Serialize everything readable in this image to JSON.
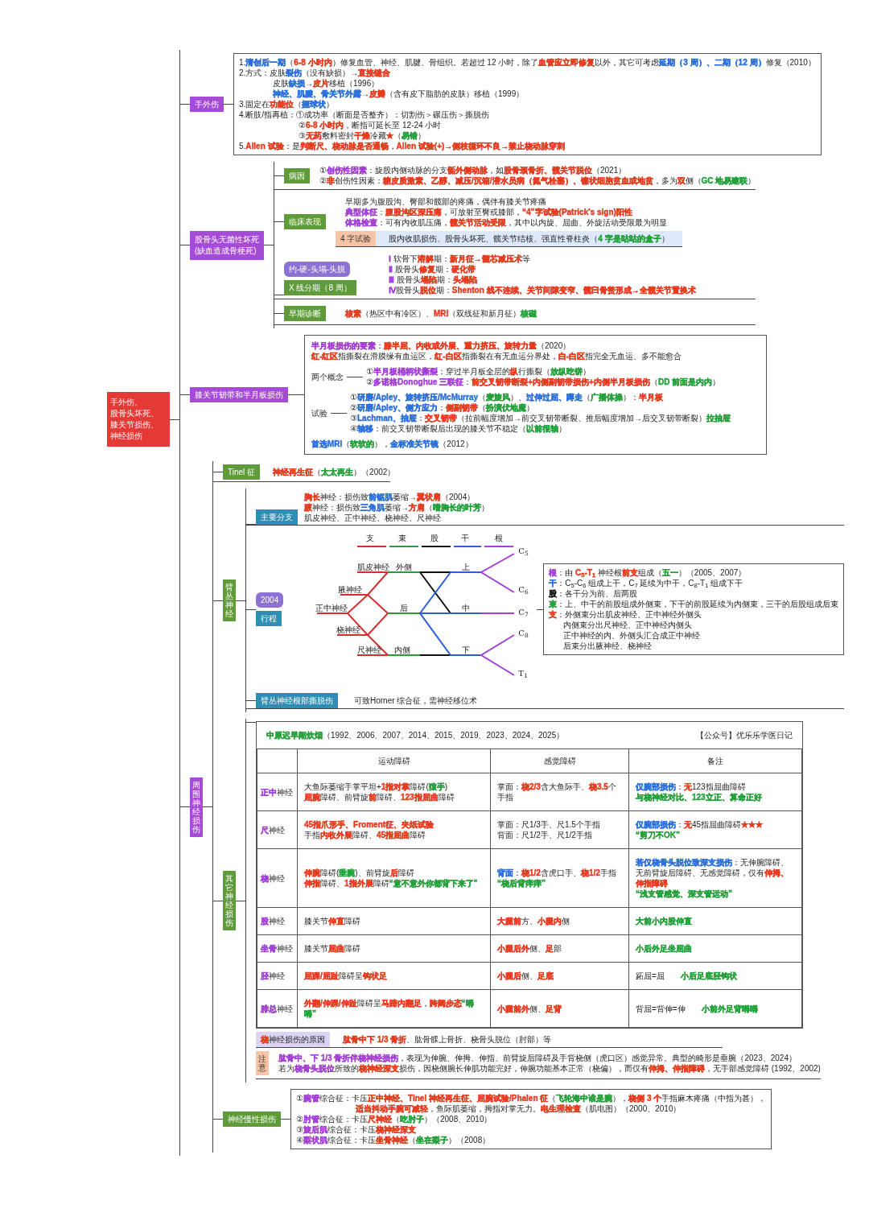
{
  "root": {
    "lines": [
      "手外伤、",
      "股骨头坏死、",
      "膝关节损伤、",
      "神经损伤"
    ]
  },
  "hand_trauma": {
    "label": "手外伤",
    "lines": [
      [
        "1.",
        {
          "text": "清创后一期",
          "color": "#2a6fdb"
        },
        "（",
        {
          "text": "6-8 小时内",
          "color": "#e53b1f"
        },
        "）修复血管、神经、肌腱、骨组织。若超过 12 小时，除了",
        {
          "text": "血管应立即修复",
          "color": "#e53b1f"
        },
        "以外，其它可考虑",
        {
          "text": "延期（3 周）、二期（12 周）",
          "color": "#2a6fdb"
        },
        "修复（2010）"
      ],
      [
        "2.方式：皮肤",
        {
          "text": "裂伤",
          "color": "#2a6fdb"
        },
        "（没有缺损）→",
        {
          "text": "直接缝合",
          "color": "#e53b1f"
        }
      ],
      {
        "kind": "sub",
        "segments": [
          "皮肤",
          {
            "text": "缺损",
            "color": "#2a6fdb"
          },
          "→",
          {
            "text": "皮片",
            "color": "#e53b1f"
          },
          "移植（1996）"
        ]
      },
      {
        "kind": "sub",
        "segments": [
          {
            "text": "神经、肌腱、骨关节外露",
            "color": "#2a6fdb"
          },
          "→",
          {
            "text": "皮瓣",
            "color": "#e53b1f"
          },
          "（含有皮下脂肪的皮肤）移植（1999）"
        ]
      },
      [
        "3.固定在",
        {
          "text": "功能位",
          "color": "#e53b1f"
        },
        "（",
        {
          "text": "握球状",
          "color": "#2a6fdb"
        },
        "）"
      ],
      [
        "4.断肢/指再植：①成功率（断面是否整齐）：切割伤＞碾压伤＞撕脱伤"
      ],
      {
        "kind": "sub2",
        "segments": [
          "②",
          {
            "text": "6-8 小时内",
            "color": "#e53b1f"
          },
          "，断指可延长至 12-24 小时"
        ]
      },
      {
        "kind": "sub2",
        "segments": [
          "③",
          {
            "text": "无药",
            "color": "#e53b1f"
          },
          "敷料密封",
          {
            "text": "干燥",
            "color": "#e53b1f"
          },
          "冷藏",
          {
            "text": "★",
            "color": "#e53b1f"
          },
          "（",
          {
            "text": "易错",
            "color": "#23a03a"
          },
          "）"
        ]
      },
      [
        "5.",
        {
          "text": "Allen 试验",
          "color": "#e53b1f"
        },
        "：是",
        {
          "text": "判断尺、桡动脉是否通畅",
          "color": "#e53b1f"
        },
        "，",
        {
          "text": "Allen 试验(+)→侧枝循环不良→禁止桡动脉穿刺",
          "color": "#e53b1f"
        }
      ]
    ]
  },
  "femoral_head_necrosis": {
    "label_lines": [
      "股骨头无菌性坏死",
      "(缺血造成骨梗死)"
    ],
    "etiology": {
      "label": "病因",
      "lines": [
        [
          "①",
          {
            "text": "创伤性因素",
            "color": "#a33fd6"
          },
          "：旋股内侧动脉的分支",
          {
            "text": "骺外侧动脉",
            "color": "#e53b1f"
          },
          "，如",
          {
            "text": "股骨颈骨折、髋关节脱位",
            "color": "#e53b1f"
          },
          "（2021）"
        ],
        [
          "②",
          {
            "text": "非",
            "color": "#e53b1f"
          },
          "创伤性因素：",
          {
            "text": "糖皮质激素、乙醇、减压/沉箱/潜水员病（氮气栓塞）、镰状细胞贫血或地贫",
            "color": "#e53b1f"
          },
          "，多为",
          {
            "text": "双",
            "color": "#e53b1f"
          },
          "侧（",
          {
            "text": "GC 地易建联",
            "color": "#23a03a"
          },
          "）"
        ]
      ]
    },
    "clinical": {
      "label": "临床表现",
      "lines": [
        [
          "早期多为腹股沟、臀部和髋部的疼痛，偶伴有膝关节疼痛"
        ],
        [
          {
            "text": "典型体征",
            "color": "#a33fd6"
          },
          "：",
          {
            "text": "腹股沟区深压痛",
            "color": "#e53b1f"
          },
          "，可放射至臀或膝部，",
          {
            "text": "“4”字试验(Patrick's sign)阳性",
            "color": "#e53b1f"
          }
        ],
        [
          {
            "text": "体格检查",
            "color": "#a33fd6"
          },
          "：可有内收肌压痛，",
          {
            "text": "髋关节活动受限",
            "color": "#e53b1f"
          },
          "，其中以内旋、屈曲、外旋活动受限最为明显"
        ]
      ],
      "four_test": {
        "label": "4 字试验",
        "text": [
          "股内收肌损伤、股骨头坏死、髋关节结核、强直性脊柱炎（",
          {
            "text": "4 字是咕咕的盒子",
            "color": "#23a03a"
          },
          "）"
        ]
      }
    },
    "xray_staging": {
      "label": "X 线分期（8 周）",
      "bubble": "约-硬-头塌-头脱",
      "lines": [
        [
          {
            "text": "Ⅰ",
            "color": "#a33fd6"
          },
          " 软骨下",
          {
            "text": "溶解",
            "color": "#e53b1f"
          },
          "期：",
          {
            "text": "新月征→髓芯减压术",
            "color": "#e53b1f"
          },
          "等"
        ],
        [
          {
            "text": "Ⅱ",
            "color": "#a33fd6"
          },
          " 股骨头",
          {
            "text": "修复",
            "color": "#e53b1f"
          },
          "期：",
          {
            "text": "硬化带",
            "color": "#e53b1f"
          }
        ],
        [
          {
            "text": "Ⅲ",
            "color": "#a33fd6"
          },
          " 股骨头",
          {
            "text": "塌陷",
            "color": "#e53b1f"
          },
          "期：",
          {
            "text": "头塌陷",
            "color": "#e53b1f"
          }
        ],
        [
          {
            "text": "Ⅳ",
            "color": "#a33fd6"
          },
          "股骨头",
          {
            "text": "脱位",
            "color": "#e53b1f"
          },
          "期：",
          {
            "text": "Shenton 线不连续、关节间隙变窄、髋臼骨赘形成→全髋关节置换术",
            "color": "#e53b1f"
          }
        ]
      ]
    },
    "early_diagnosis": {
      "label": "早期诊断",
      "text": [
        {
          "text": "核素",
          "color": "#e53b1f"
        },
        "（热区中有冷区）、",
        {
          "text": "MRI",
          "color": "#e53b1f"
        },
        "（双线征和新月征）",
        {
          "text": "核磁",
          "color": "#23a03a"
        }
      ]
    }
  },
  "knee": {
    "label": "膝关节韧带和半月板损伤",
    "intro": [
      [
        {
          "text": "半月板损伤的要素",
          "color": "#a33fd6"
        },
        "：",
        {
          "text": "膝半屈、内收或外展、重力挤压、旋转力量",
          "color": "#e53b1f"
        },
        "（2020）"
      ],
      [
        {
          "text": "红-红区",
          "color": "#e53b1f"
        },
        "指撕裂在滑膜缘有血运区，",
        {
          "text": "红-白区",
          "color": "#e53b1f"
        },
        "指撕裂在有无血运分界处，",
        {
          "text": "白-白区",
          "color": "#e53b1f"
        },
        "指完全无血运、多不能愈合"
      ]
    ],
    "groups": [
      {
        "label": "两个概念",
        "lines": [
          [
            "①",
            {
              "text": "半月板桶柄状撕裂",
              "color": "#a33fd6"
            },
            "：穿过半月板全层的",
            {
              "text": "纵",
              "color": "#e53b1f"
            },
            "行撕裂（",
            {
              "text": "放纵吃饼",
              "color": "#23a03a"
            },
            "）"
          ],
          [
            "②",
            {
              "text": "多诺格Donoghue 三联征",
              "color": "#a33fd6"
            },
            "：",
            {
              "text": "前交叉韧带断裂+内侧副韧带损伤+内侧半月板损伤",
              "color": "#e53b1f"
            },
            "（",
            {
              "text": "DD 前面是内内",
              "color": "#23a03a"
            },
            "）"
          ]
        ]
      },
      {
        "label": "试验",
        "lines": [
          [
            "①",
            {
              "text": "研磨/Apley、旋转挤压/McMurray",
              "color": "#2a6fdb"
            },
            "（",
            {
              "text": "麦旋风",
              "color": "#23a03a"
            },
            "）、",
            {
              "text": "过伸过屈、蹲走",
              "color": "#2a6fdb"
            },
            "（",
            {
              "text": "广播体操",
              "color": "#23a03a"
            },
            "）：",
            {
              "text": "半月板",
              "color": "#e53b1f"
            }
          ],
          [
            "②",
            {
              "text": "研磨/Apley、侧方应力",
              "color": "#2a6fdb"
            },
            "：",
            {
              "text": "侧副韧带",
              "color": "#e53b1f"
            },
            "（",
            {
              "text": "扮演伏地魔",
              "color": "#23a03a"
            },
            "）"
          ],
          [
            "③",
            {
              "text": "Lachman、抽屉",
              "color": "#2a6fdb"
            },
            "：",
            {
              "text": "交叉韧带",
              "color": "#e53b1f"
            },
            "（拉前幅度增加→前交叉韧带断裂、推后幅度增加→后交叉韧带断裂）",
            {
              "text": "拉抽屉",
              "color": "#23a03a"
            }
          ],
          [
            "④",
            {
              "text": "轴移",
              "color": "#2a6fdb"
            },
            "：前交叉韧带断裂后出现的膝关节不稳定（",
            {
              "text": "以前很轴",
              "color": "#23a03a"
            },
            "）"
          ]
        ]
      }
    ],
    "footer": [
      {
        "text": "首选MRI",
        "color": "#2a6fdb"
      },
      "（",
      {
        "text": "软软的",
        "color": "#23a03a"
      },
      "），",
      {
        "text": "金标准关节镜",
        "color": "#2a6fdb"
      },
      "（2012）"
    ]
  },
  "peripheral_nerve": {
    "label": "周围神经损伤",
    "tinel": {
      "label": "Tinel 征",
      "text": [
        {
          "text": "神经再生征",
          "color": "#e53b1f"
        },
        "（",
        {
          "text": "太太再生",
          "color": "#23a03a"
        },
        "）（2002）"
      ]
    },
    "brachial_plexus": {
      "label": "臂丛神经",
      "main_branches": {
        "label": "主要分支",
        "lines": [
          [
            {
              "text": "胸长",
              "color": "#e53b1f"
            },
            "神经：损伤致",
            {
              "text": "前锯肌",
              "color": "#2a6fdb"
            },
            "萎缩→",
            {
              "text": "翼状肩",
              "color": "#e53b1f"
            },
            "（2004）"
          ],
          [
            {
              "text": "腋",
              "color": "#e53b1f"
            },
            "神经：损伤致",
            {
              "text": "三角肌",
              "color": "#2a6fdb"
            },
            "萎缩→",
            {
              "text": "方肩",
              "color": "#e53b1f"
            },
            "（",
            {
              "text": "嗜胸长的叶芳",
              "color": "#23a03a"
            },
            "）"
          ],
          [
            "肌皮神经、正中神经、桡神经、尺神经"
          ]
        ]
      },
      "course": {
        "label": "行程",
        "bubble": "2004",
        "diagram": {
          "headers": [
            "支",
            "束",
            "股",
            "干",
            "根"
          ],
          "nerves": [
            "肌皮神经",
            "腋神经",
            "正中神经",
            "桡神经",
            "尺神经"
          ],
          "cords": [
            "外侧",
            "后",
            "内侧"
          ],
          "trunks": [
            "上",
            "中",
            "下"
          ],
          "roots": [
            "C$_{5}$",
            "C$_{6}$",
            "C$_{7}$",
            "C$_{8}$",
            "T$_{1}$"
          ]
        },
        "legend": [
          [
            {
              "text": "根",
              "color": "#a33fd6"
            },
            "：由 ",
            {
              "text": "C$_{5}$-T$_{1}$",
              "color": "#e53b1f"
            },
            " 神经根",
            {
              "text": "前支",
              "color": "#e53b1f"
            },
            "组成（",
            {
              "text": "五一",
              "color": "#23a03a"
            },
            "）（2005、2007）"
          ],
          [
            {
              "text": "干",
              "color": "#2a6fdb"
            },
            "：C$_{5}$-C$_{6}$ 组成上干，C$_{7}$ 延续为中干，C$_{8}$-T$_{1}$ 组成下干"
          ],
          [
            {
              "text": "股",
              "color": "#111111"
            },
            "：各干分为前、后两股"
          ],
          [
            {
              "text": "束",
              "color": "#23a03a"
            },
            "：上、中干的前股组成外侧束，下干的前股延续为内侧束，三干的后股组成后束"
          ],
          [
            {
              "text": "支",
              "color": "#e53b1f"
            },
            "：外侧束分出肌皮神经、正中神经外侧头"
          ],
          {
            "kind": "hang",
            "segments": [
              "内侧束分出尺神经、正中神经内侧头"
            ]
          },
          {
            "kind": "hang",
            "segments": [
              "正中神经的内、外侧头汇合成正中神经"
            ]
          },
          {
            "kind": "hang",
            "segments": [
              "后束分出腋神经、桡神经"
            ]
          }
        ]
      },
      "root_avulsion": {
        "label": "臂丛神经根部撕脱伤",
        "text": "可致Horner 综合征，需神经移位术"
      }
    },
    "other_nerves": {
      "label": "其它神经损伤",
      "table": {
        "mnemonic": [
          {
            "text": "中原迟早闹炊烟",
            "color": "#23a03a"
          },
          "（1992、2006、2007、2014、2015、2019、2023、2024、2025）"
        ],
        "source": "【公众号】优乐乐学医日记",
        "columns": [
          "运动障碍",
          "感觉障碍",
          "备注"
        ],
        "rows": [
          {
            "name": [
              {
                "text": "正中",
                "color": "#a33fd6"
              },
              "神经"
            ],
            "motor": [
              [
                "大鱼际萎缩手掌平坦+",
                {
                  "text": "1指对掌",
                  "color": "#e53b1f"
                },
                "障碍(",
                {
                  "text": "猿手",
                  "color": "#23a03a"
                },
                ")"
              ],
              [
                {
                  "text": "屈腕",
                  "color": "#e53b1f"
                },
                "障碍、前臂旋",
                {
                  "text": "前",
                  "color": "#e53b1f"
                },
                "障碍、",
                {
                  "text": "123指屈曲",
                  "color": "#e53b1f"
                },
                "障碍"
              ]
            ],
            "sensory": [
              [
                "掌面：",
                {
                  "text": "桡2/3",
                  "color": "#e53b1f"
                },
                "含大鱼际手、",
                {
                  "text": "桡3.5",
                  "color": "#e53b1f"
                },
                "个手指"
              ]
            ],
            "notes": [
              [
                {
                  "text": "仅腕部损伤",
                  "color": "#2a6fdb"
                },
                "：",
                {
                  "text": "无",
                  "color": "#e53b1f"
                },
                "123指屈曲障碍"
              ],
              [
                {
                  "text": "与桡神经对比、123立正、算命正好",
                  "color": "#23a03a"
                }
              ]
            ]
          },
          {
            "name": [
              {
                "text": "尺",
                "color": "#a33fd6"
              },
              "神经"
            ],
            "motor": [
              [
                {
                  "text": "45指爪形手、Froment征、夹纸试验",
                  "color": "#e53b1f"
                }
              ],
              [
                "手指",
                {
                  "text": "内收外展",
                  "color": "#e53b1f"
                },
                "障碍、",
                {
                  "text": "45指屈曲",
                  "color": "#e53b1f"
                },
                "障碍"
              ]
            ],
            "sensory": [
              [
                "掌面：尺1/3手、尺1.5个手指"
              ],
              [
                "背面：尺1/2手、尺1/2手指"
              ]
            ],
            "notes": [
              [
                {
                  "text": "仅腕部损伤",
                  "color": "#2a6fdb"
                },
                "：",
                {
                  "text": "无",
                  "color": "#e53b1f"
                },
                "45指屈曲障碍",
                {
                  "text": "★★★",
                  "color": "#e53b1f"
                }
              ],
              [
                {
                  "text": "“剪刀不OK”",
                  "color": "#23a03a"
                }
              ]
            ]
          },
          {
            "name": [
              {
                "text": "桡",
                "color": "#a33fd6"
              },
              "神经"
            ],
            "motor": [
              [
                {
                  "text": "伸腕",
                  "color": "#e53b1f"
                },
                "障碍(",
                {
                  "text": "垂腕",
                  "color": "#23a03a"
                },
                ")、前臂旋",
                {
                  "text": "后",
                  "color": "#e53b1f"
                },
                "障碍"
              ],
              [
                {
                  "text": "伸指",
                  "color": "#e53b1f"
                },
                "障碍、",
                {
                  "text": "1指外展",
                  "color": "#e53b1f"
                },
                "障碍",
                {
                  "text": "“意不意外你都背下来了”",
                  "color": "#23a03a"
                }
              ]
            ],
            "sensory": [
              [
                {
                  "text": "背面",
                  "color": "#2a6fdb"
                },
                "：",
                {
                  "text": "桡1/2",
                  "color": "#e53b1f"
                },
                "含虎口手、",
                {
                  "text": "桡1/2",
                  "color": "#e53b1f"
                },
                "手指"
              ],
              [
                {
                  "text": "“桡后背痒痒”",
                  "color": "#23a03a"
                }
              ]
            ],
            "notes": [
              [
                {
                  "text": "若仅桡骨头脱位致深支损伤",
                  "color": "#2a6fdb"
                },
                "：无伸腕障碍、无前臂旋后障碍、无感觉障碍，仅有",
                {
                  "text": "伸拇、伸指障碍",
                  "color": "#e53b1f"
                }
              ],
              [
                {
                  "text": "“浅支管感觉、深支管运动”",
                  "color": "#23a03a"
                }
              ]
            ]
          },
          {
            "name": [
              {
                "text": "股",
                "color": "#a33fd6"
              },
              "神经"
            ],
            "motor": [
              [
                "膝关节",
                {
                  "text": "伸直",
                  "color": "#e53b1f"
                },
                "障碍"
              ]
            ],
            "sensory": [
              [
                {
                  "text": "大腿前",
                  "color": "#e53b1f"
                },
                "方、",
                {
                  "text": "小腿内",
                  "color": "#e53b1f"
                },
                "侧"
              ]
            ],
            "notes": [
              [
                {
                  "text": "大前小内股伸直",
                  "color": "#23a03a"
                }
              ]
            ]
          },
          {
            "name": [
              {
                "text": "坐骨",
                "color": "#a33fd6"
              },
              "神经"
            ],
            "motor": [
              [
                "膝关节",
                {
                  "text": "屈曲",
                  "color": "#e53b1f"
                },
                "障碍"
              ]
            ],
            "sensory": [
              [
                {
                  "text": "小腿后外",
                  "color": "#e53b1f"
                },
                "侧、",
                {
                  "text": "足",
                  "color": "#e53b1f"
                },
                "部"
              ]
            ],
            "notes": [
              [
                {
                  "text": "小后外足坐屈曲",
                  "color": "#23a03a"
                }
              ]
            ]
          },
          {
            "name": [
              {
                "text": "胫",
                "color": "#a33fd6"
              },
              "神经"
            ],
            "motor": [
              [
                {
                  "text": "屈踝/屈趾",
                  "color": "#e53b1f"
                },
                "障碍呈",
                {
                  "text": "钩状足",
                  "color": "#e53b1f"
                }
              ]
            ],
            "sensory": [
              [
                {
                  "text": "小腿后",
                  "color": "#e53b1f"
                },
                "侧、",
                {
                  "text": "足底",
                  "color": "#e53b1f"
                }
              ]
            ],
            "notes": [
              [
                "跖屈=屈　　",
                {
                  "text": "小后足底胫钩状",
                  "color": "#23a03a"
                }
              ]
            ]
          },
          {
            "name": [
              {
                "text": "腓总",
                "color": "#a33fd6"
              },
              "神经"
            ],
            "motor": [
              [
                {
                  "text": "外翻/伸踝/伸趾",
                  "color": "#e53b1f"
                },
                "障碍呈",
                {
                  "text": "马蹄内翻足",
                  "color": "#e53b1f"
                },
                "，",
                {
                  "text": "跨阈步态",
                  "color": "#e53b1f"
                },
                {
                  "text": "“嘚嘚”",
                  "color": "#23a03a"
                }
              ]
            ],
            "sensory": [
              [
                {
                  "text": "小腿前外",
                  "color": "#e53b1f"
                },
                "侧、",
                {
                  "text": "足背",
                  "color": "#e53b1f"
                }
              ]
            ],
            "notes": [
              [
                "背屈=背伸=伸　　",
                {
                  "text": "小前外足背嘚嘚",
                  "color": "#23a03a"
                }
              ]
            ]
          }
        ]
      },
      "radial_causes": {
        "label": [
          {
            "text": "桡",
            "color": "#e53b1f"
          },
          "神经损伤的原因"
        ],
        "text": [
          {
            "text": "肱骨中下 1/3 骨折",
            "color": "#e53b1f"
          },
          "、肱骨髁上骨折、桡骨头脱位（肘部）等"
        ]
      },
      "caution": {
        "label": "注意",
        "lines": [
          [
            {
              "text": "肱骨中、下 1/3 骨折伴桡神经损伤",
              "color": "#a33fd6"
            },
            "，表现为伸腕、伸拇、伸指、前臂旋后障碍及手背桡侧（虎口区）感觉异常。典型的畸形是垂腕（2023、2024）"
          ],
          [
            "若为",
            {
              "text": "桡骨头脱位",
              "color": "#a33fd6"
            },
            "所致的",
            {
              "text": "桡神经深支",
              "color": "#e53b1f"
            },
            "损伤，因桡侧腕长伸肌功能完好，伸腕功能基本正常（桡偏），而仅有",
            {
              "text": "伸拇、伸指障碍",
              "color": "#e53b1f"
            },
            "，无手部感觉障碍 (1992、2002)"
          ]
        ]
      }
    },
    "chronic": {
      "label": "神经慢性损伤",
      "lines": [
        [
          "①",
          {
            "text": "腕管",
            "color": "#a33fd6"
          },
          "综合征：卡压",
          {
            "text": "正中神经、Tinel 神经再生征、屈腕试验/Phalen 征",
            "color": "#e53b1f"
          },
          "（",
          {
            "text": "飞轮海中谁是腕",
            "color": "#23a03a"
          },
          "），",
          {
            "text": "桡侧 3 个",
            "color": "#e53b1f"
          },
          "手指麻木疼痛（中指为甚），"
        ],
        {
          "kind": "sub2",
          "segments": [
            {
              "text": "适当抖动手腕可减轻",
              "color": "#e53b1f"
            },
            "，鱼际肌萎缩，拇指对掌无力。",
            {
              "text": "电生理检查",
              "color": "#e53b1f"
            },
            "（肌电图）（2000、2010）"
          ]
        },
        [
          "②",
          {
            "text": "肘管",
            "color": "#a33fd6"
          },
          "综合征：卡压",
          {
            "text": "尺神经",
            "color": "#e53b1f"
          },
          "（",
          {
            "text": "吃肘子",
            "color": "#23a03a"
          },
          "）（2008、2010）"
        ],
        [
          "③",
          {
            "text": "旋后肌",
            "color": "#a33fd6"
          },
          "综合征：卡压",
          {
            "text": "桡神经深支",
            "color": "#e53b1f"
          }
        ],
        [
          "④",
          {
            "text": "梨状肌",
            "color": "#a33fd6"
          },
          "综合征：卡压",
          {
            "text": "坐骨神经",
            "color": "#e53b1f"
          },
          "（",
          {
            "text": "坐在梨子",
            "color": "#23a03a"
          },
          "）（2008）"
        ]
      ]
    }
  }
}
